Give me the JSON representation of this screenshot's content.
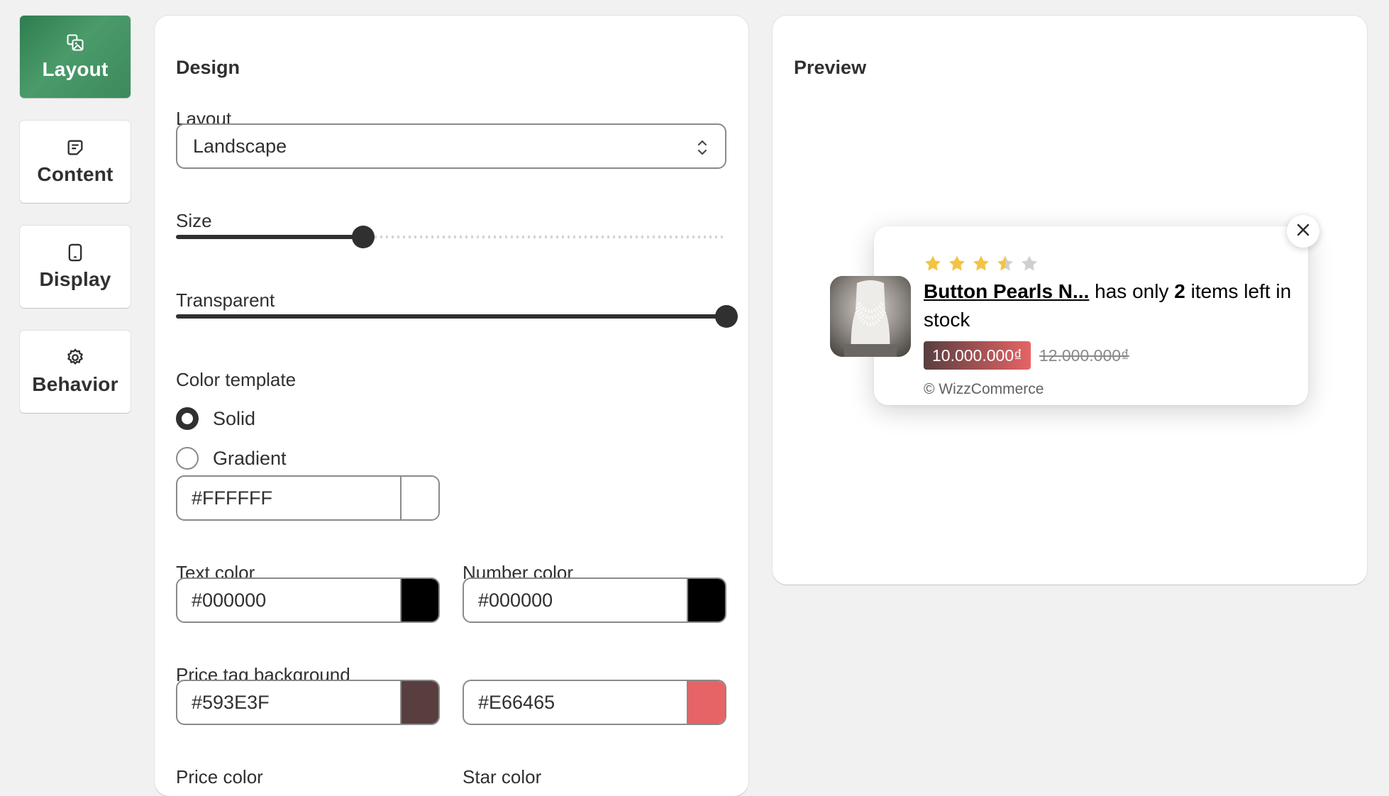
{
  "nav": {
    "items": [
      {
        "label": "Layout",
        "icon": "layout-icon",
        "active": true
      },
      {
        "label": "Content",
        "icon": "content-icon",
        "active": false
      },
      {
        "label": "Display",
        "icon": "display-icon",
        "active": false
      },
      {
        "label": "Behavior",
        "icon": "gear-icon",
        "active": false
      }
    ]
  },
  "design": {
    "title": "Design",
    "layout_label": "Layout",
    "layout_value": "Landscape",
    "size_label": "Size",
    "size_value": 0.34,
    "transparent_label": "Transparent",
    "transparent_value": 1.0,
    "color_template_label": "Color template",
    "radio_solid": "Solid",
    "radio_gradient": "Gradient",
    "selected_template": "Solid",
    "bg_color": "#FFFFFF",
    "text_color_label": "Text color",
    "text_color": "#000000",
    "number_color_label": "Number color",
    "number_color": "#000000",
    "price_tag_bg_label": "Price tag background",
    "price_tag_bg_start": "#593E3F",
    "price_tag_bg_end": "#E66465",
    "price_color_label": "Price color",
    "star_color_label": "Star color"
  },
  "preview": {
    "title": "Preview",
    "product_name": "Button Pearls N...",
    "text_before": " has only ",
    "count": "2",
    "text_after": " items left in stock",
    "price": "10.000.000₫",
    "old_price": "12.000.000₫",
    "brand": "© WizzCommerce",
    "rating": 3.5,
    "star_color": "#F5C342",
    "star_empty_color": "#CFCFCF"
  }
}
